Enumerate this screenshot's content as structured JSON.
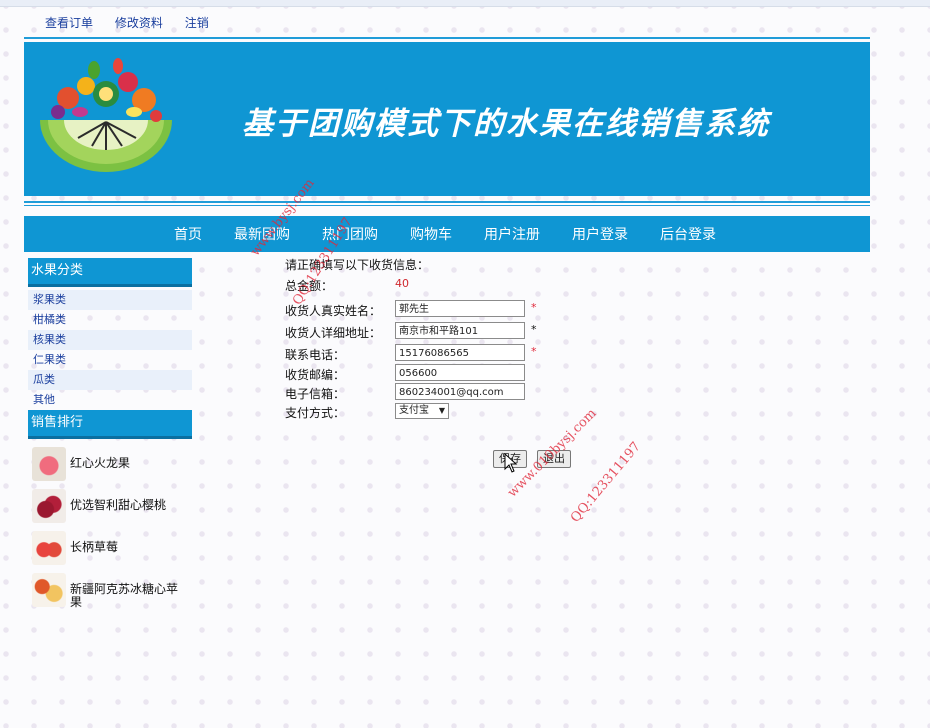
{
  "top_links": [
    "查看订单",
    "修改资料",
    "注销"
  ],
  "banner": {
    "title": "基于团购模式下的水果在线销售系统"
  },
  "nav": [
    "首页",
    "最新团购",
    "热门团购",
    "购物车",
    "用户注册",
    "用户登录",
    "后台登录"
  ],
  "sidebar": {
    "category_title": "水果分类",
    "categories": [
      "浆果类",
      "柑橘类",
      "核果类",
      "仁果类",
      "瓜类",
      "其他"
    ],
    "ranking_title": "销售排行",
    "products": [
      "红心火龙果",
      "优选智利甜心樱桃",
      "长柄草莓",
      "新疆阿克苏冰糖心苹果"
    ]
  },
  "form": {
    "intro": "请正确填写以下收货信息：",
    "total_label": "总金额：",
    "total_value": "40",
    "name_label": "收货人真实姓名：",
    "name_value": "郭先生",
    "address_label": "收货人详细地址：",
    "address_value": "南京市和平路101",
    "phone_label": "联系电话：",
    "phone_value": "15176086565",
    "zip_label": "收货邮编：",
    "zip_value": "056600",
    "email_label": "电子信箱：",
    "email_value": "860234001@qq.com",
    "payment_label": "支付方式：",
    "payment_selected": "支付宝",
    "required_mark": "*",
    "save_label": "保存",
    "exit_label": "退出"
  },
  "watermarks": [
    "www.bysj.com",
    "QQ:123311197",
    "www.010bysj.com",
    "QQ:123311197"
  ],
  "colors": {
    "accent": "#0f96d3",
    "link": "#1b3f9e",
    "required": "#e0283a"
  }
}
